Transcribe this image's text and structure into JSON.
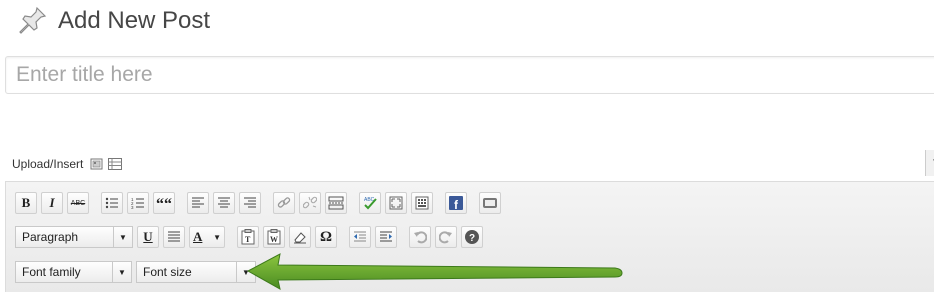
{
  "header": {
    "title": "Add New Post",
    "icon": "pushpin-icon"
  },
  "title_field": {
    "value": "",
    "placeholder": "Enter title here"
  },
  "upload": {
    "label": "Upload/Insert",
    "icons": [
      "add-media-icon",
      "gallery-icon"
    ]
  },
  "toolbar": {
    "row1": [
      "bold",
      "italic",
      "strikethrough",
      "bulleted-list",
      "numbered-list",
      "blockquote",
      "align-left",
      "align-center",
      "align-right",
      "insert-link",
      "unlink",
      "insert-more",
      "spellcheck",
      "fullscreen",
      "toggle-kitchen-sink",
      "facebook",
      "embed"
    ],
    "bold_label": "B",
    "italic_label": "I",
    "strike_label": "ABC",
    "quote_label": "““",
    "row2": {
      "format_select": "Paragraph",
      "underline_label": "U",
      "textcolor_label": "A",
      "omega_label": "Ω"
    },
    "row3": {
      "font_family": "Font family",
      "font_size": "Font size"
    }
  },
  "accent_colors": {
    "arrow": "#5ca42a",
    "spellcheck": "#3a9b2e",
    "facebook": "#3b5998"
  }
}
